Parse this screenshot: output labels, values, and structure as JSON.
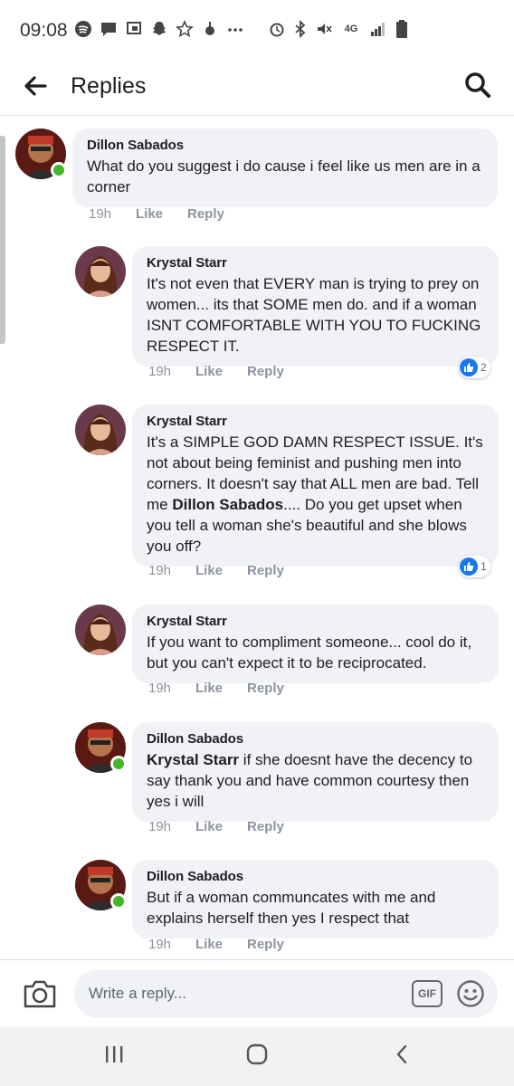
{
  "status_bar": {
    "time": "09:08",
    "network": "4G"
  },
  "header": {
    "title": "Replies"
  },
  "comments": [
    {
      "author": "Dillon Sabados",
      "text": "What do you suggest i do cause i feel like us men are in a corner",
      "time": "19h",
      "like_label": "Like",
      "reply_label": "Reply"
    },
    {
      "author": "Krystal Starr",
      "text": "It's not even that EVERY man is trying to prey on women... its that SOME men do. and if a woman ISNT COMFORTABLE WITH YOU TO FUCKING RESPECT IT.",
      "time": "19h",
      "like_label": "Like",
      "reply_label": "Reply",
      "reaction_count": "2"
    },
    {
      "author": "Krystal Starr",
      "text_before": "It's a SIMPLE GOD DAMN RESPECT ISSUE. It's not about being feminist and pushing men into corners.   It doesn't say that ALL men are bad. Tell me ",
      "mention": "Dillon Sabados",
      "text_after": ".... Do you get upset when you tell a woman she's beautiful and she blows you off?",
      "time": "19h",
      "like_label": "Like",
      "reply_label": "Reply",
      "reaction_count": "1"
    },
    {
      "author": "Krystal Starr",
      "text": "If you want to compliment someone... cool do it, but you can't expect it to be reciprocated.",
      "time": "19h",
      "like_label": "Like",
      "reply_label": "Reply"
    },
    {
      "author": "Dillon Sabados",
      "mention": "Krystal Starr",
      "text_after": " if she doesnt have the decency to say thank you and have common courtesy then yes i will",
      "time": "19h",
      "like_label": "Like",
      "reply_label": "Reply"
    },
    {
      "author": "Dillon Sabados",
      "text": "But if a woman communcates with me and explains herself then yes I respect that",
      "time": "19h",
      "like_label": "Like",
      "reply_label": "Reply"
    }
  ],
  "composer": {
    "placeholder": "Write a reply...",
    "gif_label": "GIF"
  },
  "colors": {
    "accent": "#1877f2",
    "online": "#42b72a",
    "bubble": "#f0f2f5",
    "meta_text": "#8d949e"
  },
  "icons": {
    "back": "arrow-left-icon",
    "search": "search-icon",
    "camera": "camera-icon",
    "emoji": "smiley-icon",
    "like_reaction": "thumbs-up-icon",
    "nav_recents": "recents-icon",
    "nav_home": "home-icon",
    "nav_back": "chevron-left-icon"
  }
}
